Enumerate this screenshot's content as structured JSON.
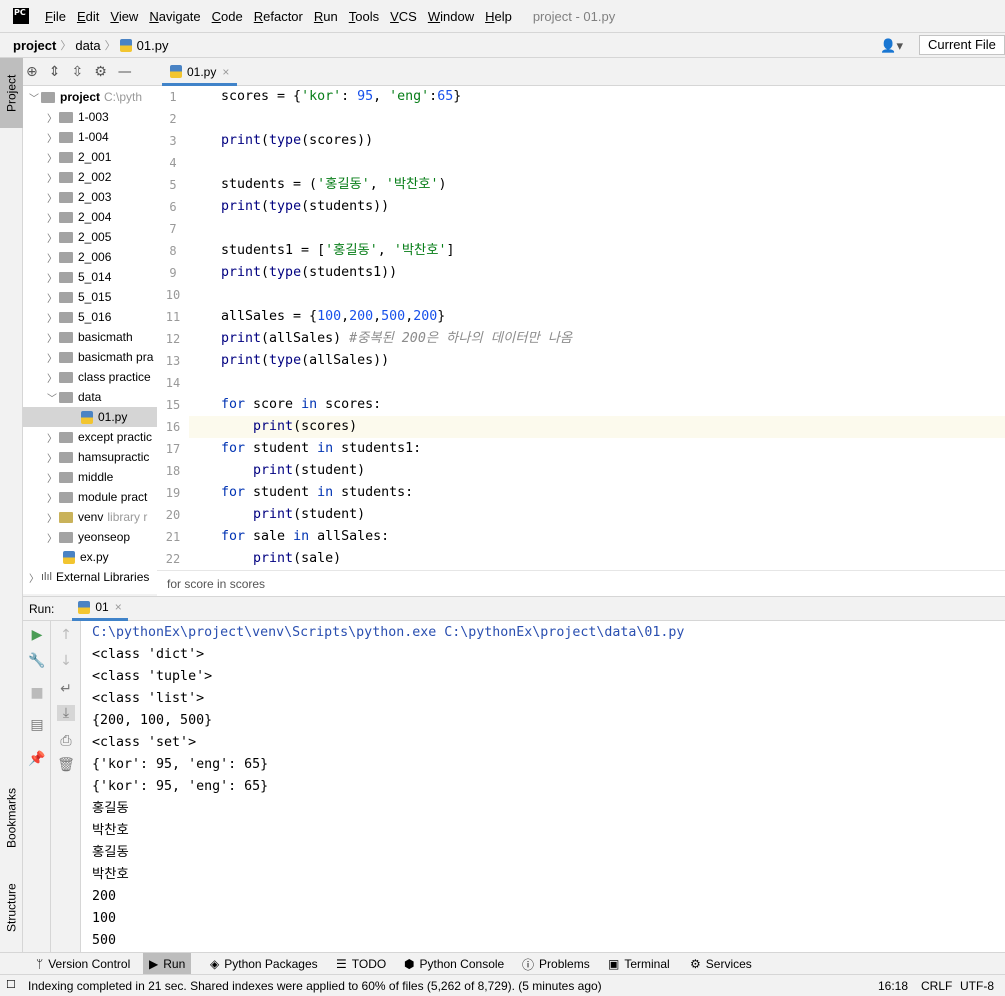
{
  "menubar": {
    "logo_text": "PC",
    "items": [
      "File",
      "Edit",
      "View",
      "Navigate",
      "Code",
      "Refactor",
      "Run",
      "Tools",
      "VCS",
      "Window",
      "Help"
    ],
    "window_title": "project - 01.py"
  },
  "navbar": {
    "crumbs": [
      "project",
      "data",
      "01.py"
    ],
    "run_config": "Current File"
  },
  "left_stripe": {
    "project": "Project",
    "bookmarks": "Bookmarks",
    "structure": "Structure"
  },
  "project_tree": {
    "root_label": "project",
    "root_path": "C:\\pyth",
    "items": [
      {
        "label": "1-003",
        "kind": "folder"
      },
      {
        "label": "1-004",
        "kind": "folder"
      },
      {
        "label": "2_001",
        "kind": "folder"
      },
      {
        "label": "2_002",
        "kind": "folder"
      },
      {
        "label": "2_003",
        "kind": "folder"
      },
      {
        "label": "2_004",
        "kind": "folder"
      },
      {
        "label": "2_005",
        "kind": "folder"
      },
      {
        "label": "2_006",
        "kind": "folder"
      },
      {
        "label": "5_014",
        "kind": "folder"
      },
      {
        "label": "5_015",
        "kind": "folder"
      },
      {
        "label": "5_016",
        "kind": "folder"
      },
      {
        "label": "basicmath",
        "kind": "folder"
      },
      {
        "label": "basicmath pra",
        "kind": "folder"
      },
      {
        "label": "class practice",
        "kind": "folder"
      },
      {
        "label": "data",
        "kind": "folder-open"
      },
      {
        "label": "01.py",
        "kind": "file-selected"
      },
      {
        "label": "except practic",
        "kind": "folder"
      },
      {
        "label": "hamsupractic",
        "kind": "folder"
      },
      {
        "label": "middle",
        "kind": "folder"
      },
      {
        "label": "module pract",
        "kind": "folder"
      },
      {
        "label": "venv",
        "kind": "folder-venv",
        "extra": "library r"
      },
      {
        "label": "yeonseop",
        "kind": "folder"
      },
      {
        "label": "ex.py",
        "kind": "file"
      },
      {
        "label": "External Libraries",
        "kind": "libs"
      }
    ]
  },
  "editor": {
    "tab_label": "01.py",
    "current_line": 16,
    "lines": [
      "scores = {'kor': 95, 'eng':65}",
      "",
      "print(type(scores))",
      "",
      "students = ('홍길동', '박찬호')",
      "print(type(students))",
      "",
      "students1 = ['홍길동', '박찬호']",
      "print(type(students1))",
      "",
      "allSales = {100,200,500,200}",
      "print(allSales) #중복된 200은 하나의 데이터만 나옴",
      "print(type(allSales))",
      "",
      "for score in scores:",
      "    print(scores)",
      "for student in students1:",
      "    print(student)",
      "for student in students:",
      "    print(student)",
      "for sale in allSales:",
      "    print(sale)"
    ],
    "breadcrumb": "for score in scores"
  },
  "run_panel": {
    "label": "Run:",
    "tab": "01",
    "output": [
      "C:\\pythonEx\\project\\venv\\Scripts\\python.exe C:\\pythonEx\\project\\data\\01.py",
      "<class 'dict'>",
      "<class 'tuple'>",
      "<class 'list'>",
      "{200, 100, 500}",
      "<class 'set'>",
      "{'kor': 95, 'eng': 65}",
      "{'kor': 95, 'eng': 65}",
      "홍길동",
      "박찬호",
      "홍길동",
      "박찬호",
      "200",
      "100",
      "500"
    ]
  },
  "bottom_tabs": [
    "Version Control",
    "Run",
    "Python Packages",
    "TODO",
    "Python Console",
    "Problems",
    "Terminal",
    "Services"
  ],
  "status": {
    "message": "Indexing completed in 21 sec. Shared indexes were applied to 60% of files (5,262 of 8,729). (5 minutes ago)",
    "position": "16:18",
    "line_sep": "CRLF",
    "encoding": "UTF-8"
  },
  "colors": {
    "keyword": "#0033b3",
    "string": "#067d17",
    "number": "#1750eb",
    "comment": "#8c8c8c",
    "tab_underline": "#4083c9",
    "run_green": "#499c54"
  }
}
